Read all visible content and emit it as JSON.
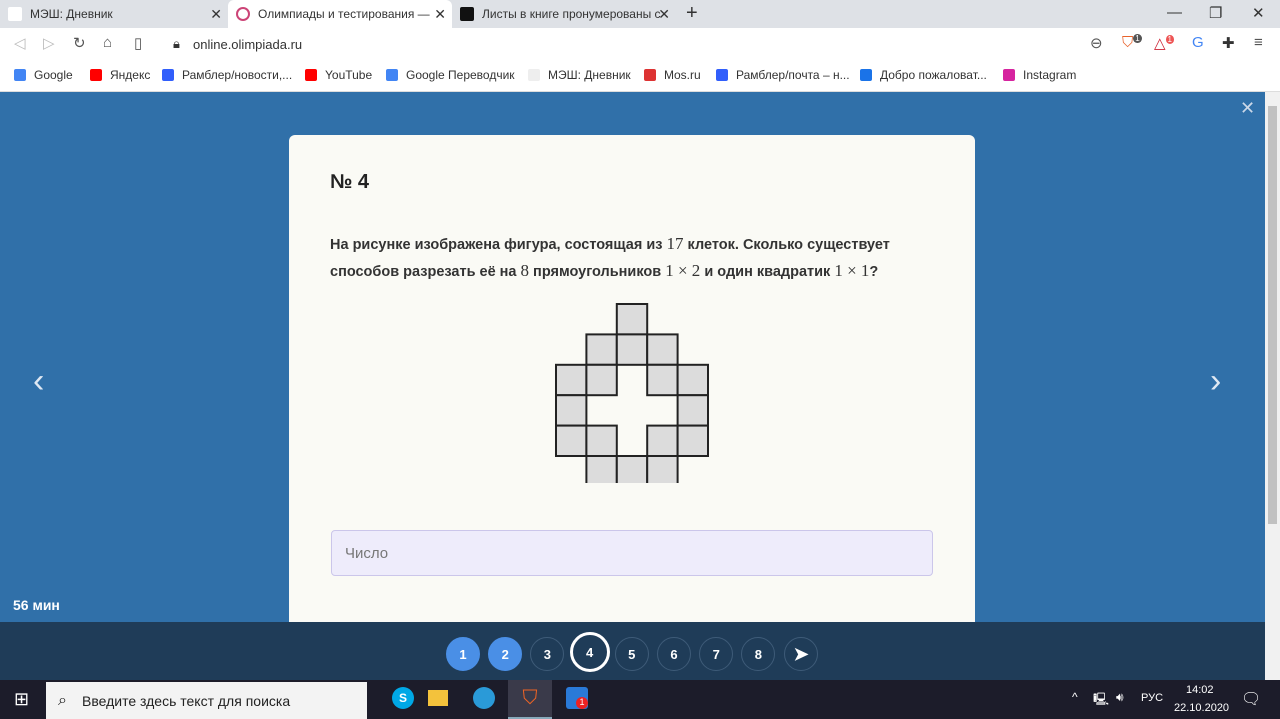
{
  "browser": {
    "tabs": [
      {
        "title": "МЭШ: Дневник"
      },
      {
        "title": "Олимпиады и тестирования — Ц"
      },
      {
        "title": "Листы в книге пронумерованы с"
      }
    ],
    "url": "online.olimpiada.ru",
    "badges": {
      "brave": "1",
      "rewards": "1"
    },
    "bookmarks": [
      {
        "label": "Google",
        "color": "#4285f4"
      },
      {
        "label": "Яндекс",
        "color": "#f00"
      },
      {
        "label": "Рамблер/новости,...",
        "color": "#315efb"
      },
      {
        "label": "YouTube",
        "color": "#f00"
      },
      {
        "label": "Google Переводчик",
        "color": "#4285f4"
      },
      {
        "label": "МЭШ: Дневник",
        "color": "#eee"
      },
      {
        "label": "Mos.ru",
        "color": "#d33"
      },
      {
        "label": "Рамблер/почта – н...",
        "color": "#315efb"
      },
      {
        "label": "Добро пожаловат...",
        "color": "#1a73e8"
      },
      {
        "label": "Instagram",
        "color": "#d6249f"
      }
    ]
  },
  "task": {
    "number": "№ 4",
    "text_1": "На рисунке изображена фигура, состоящая из ",
    "n17": "17",
    "text_2": " клеток. Сколько существует способов разрезать её на ",
    "n8": "8",
    "text_3": " прямоугольников ",
    "rect": "1 × 2",
    "text_4": " и один квадратик ",
    "sq": "1 × 1",
    "text_5": "?",
    "figure_rows": [
      "..X..",
      ".XXX.",
      "XX.XX",
      "X...X",
      "XX.XX",
      ".XXX."
    ],
    "answer_placeholder": "Число"
  },
  "timer": "56 мин",
  "pagination": [
    {
      "label": "1",
      "state": "done"
    },
    {
      "label": "2",
      "state": "done"
    },
    {
      "label": "3",
      "state": "todo"
    },
    {
      "label": "4",
      "state": "current"
    },
    {
      "label": "5",
      "state": "todo"
    },
    {
      "label": "6",
      "state": "todo"
    },
    {
      "label": "7",
      "state": "todo"
    },
    {
      "label": "8",
      "state": "todo"
    }
  ],
  "taskbar": {
    "search_placeholder": "Введите здесь текст для поиска",
    "lang": "РУС",
    "time": "14:02",
    "date": "22.10.2020",
    "edge_badge": "1"
  }
}
